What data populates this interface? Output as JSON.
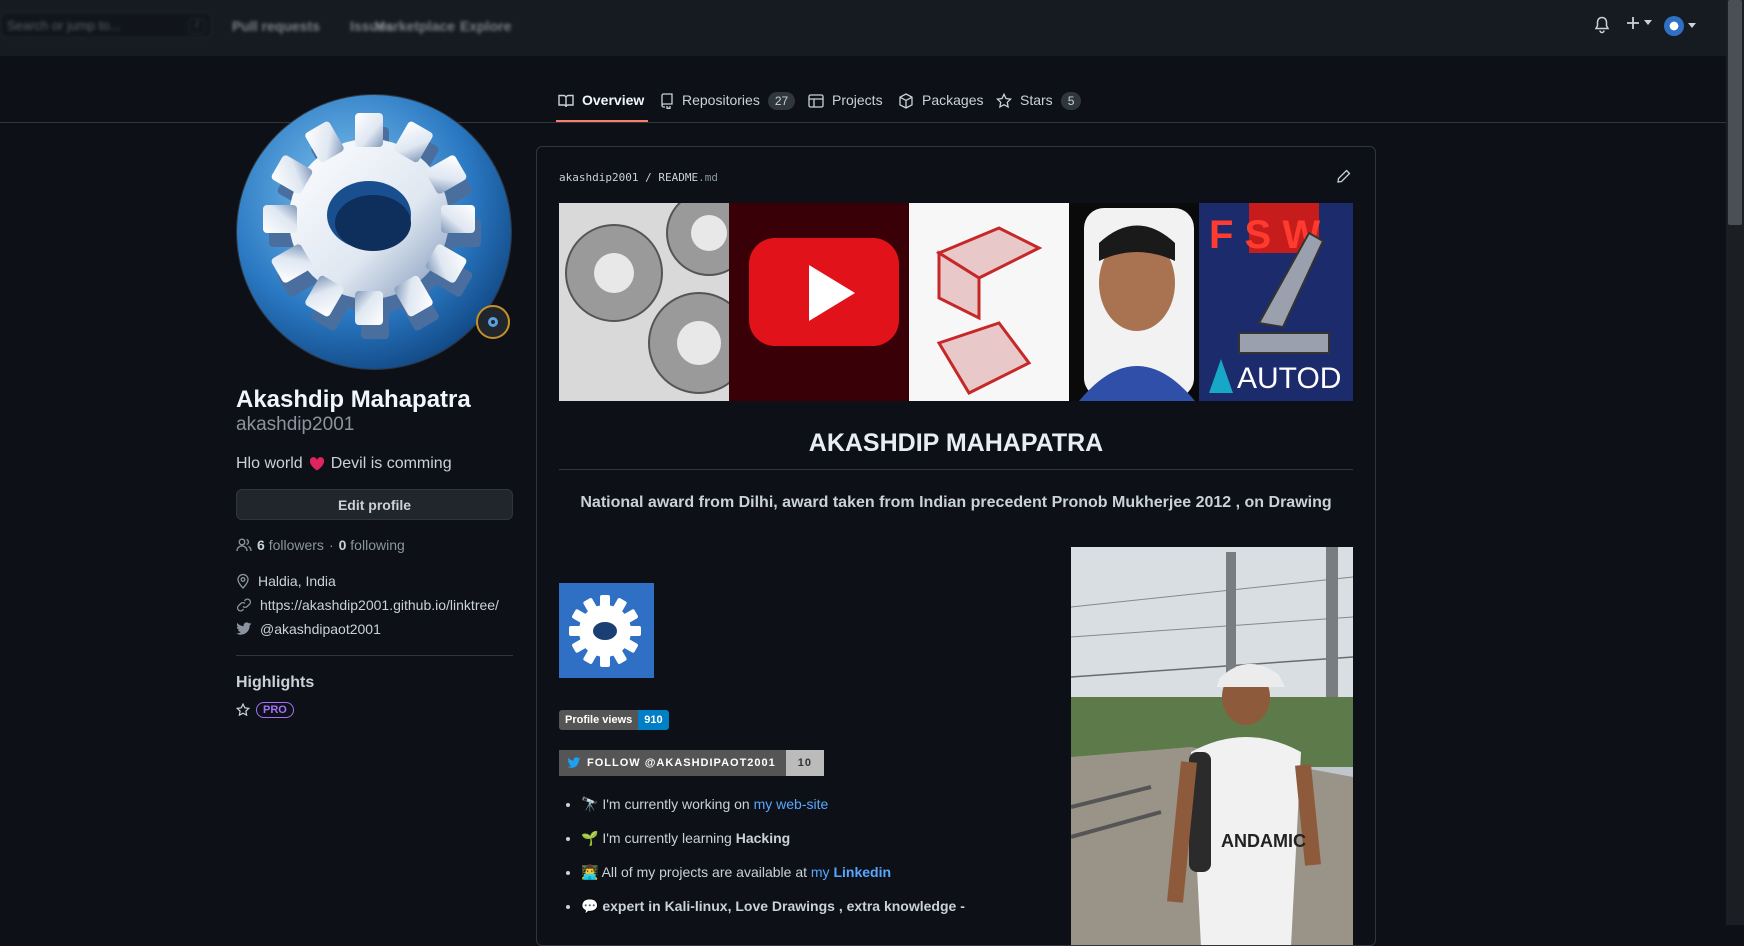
{
  "header": {
    "search_placeholder": "Search or jump to...",
    "search_shortcut": "/",
    "nav": [
      "Pull requests",
      "Issues",
      "Marketplace",
      "Explore"
    ]
  },
  "tabs": [
    {
      "label": "Overview",
      "count": null,
      "active": true
    },
    {
      "label": "Repositories",
      "count": "27"
    },
    {
      "label": "Projects",
      "count": null
    },
    {
      "label": "Packages",
      "count": null
    },
    {
      "label": "Stars",
      "count": "5"
    }
  ],
  "profile": {
    "name": "Akashdip Mahapatra",
    "login": "akashdip2001",
    "bio_part1": "Hlo world",
    "bio_part2": "Devil is comming",
    "edit_label": "Edit profile",
    "followers_count": "6",
    "followers_label": "followers",
    "separator": "·",
    "following_count": "0",
    "following_label": "following",
    "location": "Haldia, India",
    "website": "https://akashdip2001.github.io/linktree/",
    "twitter": "@akashdipaot2001",
    "highlights_title": "Highlights",
    "pro_label": "PRO"
  },
  "readme": {
    "owner": "akashdip2001",
    "sep": "/",
    "file_base": "README",
    "file_ext": ".md",
    "banner_text": "AUTOD",
    "banner_brand_letters": "F S W",
    "title": "AKASHDIP MAHAPATRA",
    "award": "National award from Dilhi, award taken from Indian precedent Pronob Mukherjee 2012 , on Drawing",
    "views_label": "Profile views",
    "views_value": "910",
    "follow_badge_label": "FOLLOW @AKASHDIPAOT2001",
    "follow_badge_count": "10",
    "tshirt_text": "ANDAMIC",
    "bullets": {
      "b1_pre": "I'm currently working on",
      "b1_link": "my web-site",
      "b2_pre": "I'm currently learning",
      "b2_bold": "Hacking",
      "b3_pre": "All of my projects are available at",
      "b3_link_a": "my",
      "b3_link_b": "Linkedin",
      "b4_text": "expert in Kali-linux, Love Drawings , extra knowledge -"
    }
  },
  "colors": {
    "bg": "#0d1117",
    "header": "#161b22",
    "border": "#30363d",
    "link": "#58a6ff",
    "tab_underline": "#f78166",
    "pro": "#a371f7",
    "views_badge": "#007ec6"
  }
}
